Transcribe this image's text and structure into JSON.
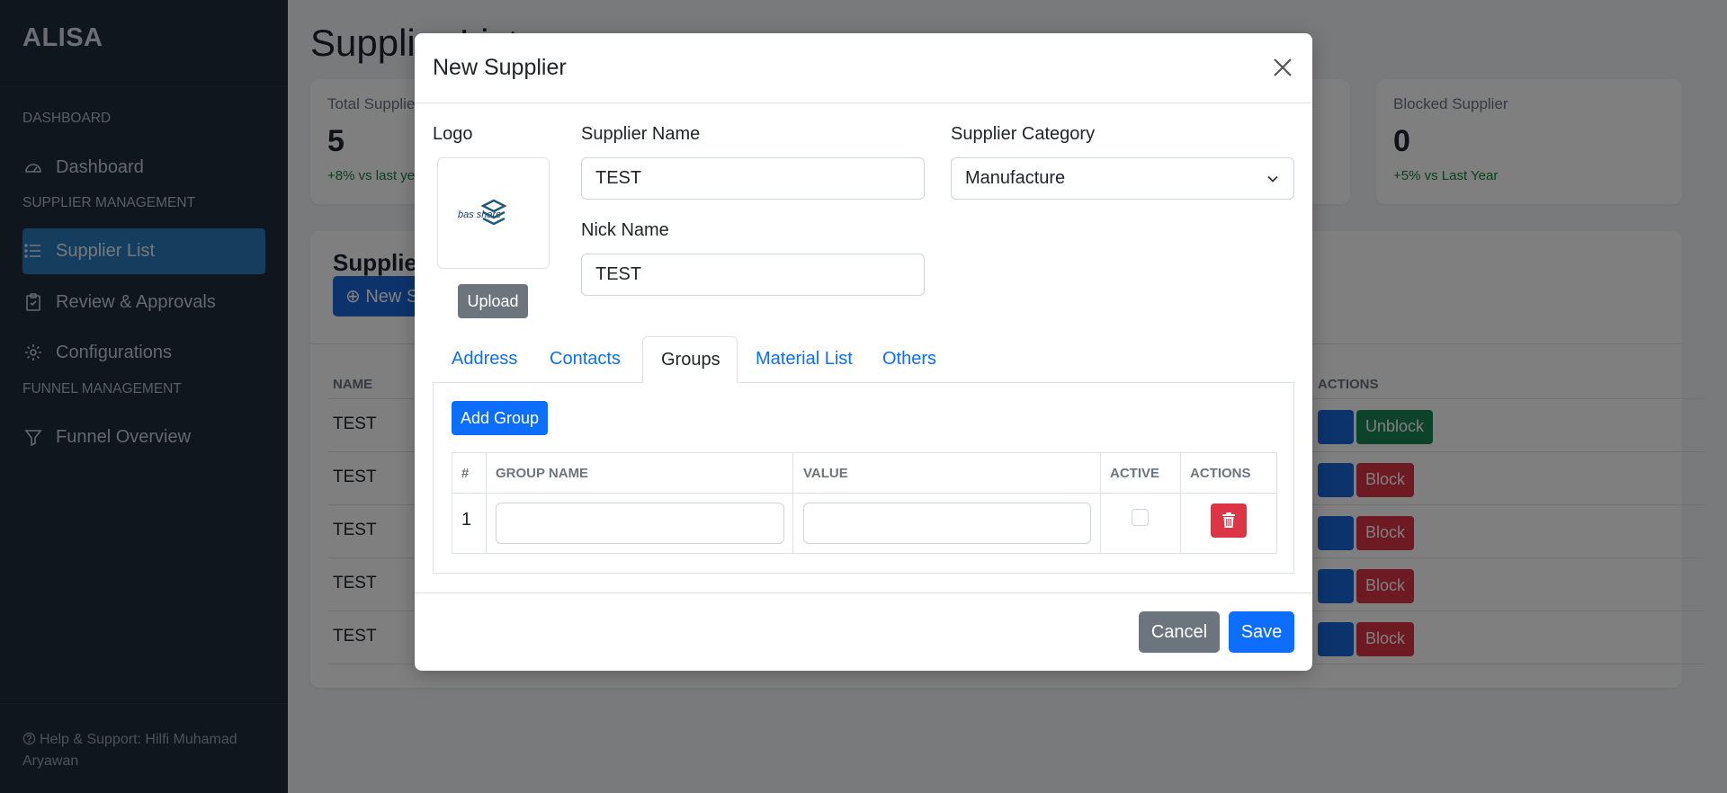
{
  "sidebar": {
    "brand": "ALISA",
    "sections": [
      "DASHBOARD",
      "SUPPLIER MANAGEMENT",
      "FUNNEL MANAGEMENT"
    ],
    "items": [
      {
        "label": "Dashboard",
        "icon": "gauge-icon"
      },
      {
        "label": "Supplier List",
        "icon": "list-icon",
        "active": true
      },
      {
        "label": "Review & Approvals",
        "icon": "clipboard-icon"
      },
      {
        "label": "Configurations",
        "icon": "gear-icon"
      },
      {
        "label": "Funnel Overview",
        "icon": "funnel-icon"
      }
    ],
    "footer": "Help & Support: Hilfi Muhamad Aryawan"
  },
  "page": {
    "title": "Supplier List",
    "stats": [
      {
        "label": "Total Supplier",
        "value": "5",
        "delta": "+8% vs last year"
      },
      {
        "label": "Blocked Supplier",
        "value": "0",
        "delta": "+5% vs Last Year"
      }
    ],
    "list_title": "Supplier List",
    "new_button": "New Supplier",
    "table": {
      "headers": [
        "NAME",
        "ACTIONS"
      ],
      "rows": [
        {
          "name": "TEST",
          "action": "Unblock"
        },
        {
          "name": "TEST",
          "action": "Block"
        },
        {
          "name": "TEST",
          "action": "Block"
        },
        {
          "name": "TEST",
          "action": "Block"
        },
        {
          "name": "TEST",
          "action": "Block"
        }
      ]
    }
  },
  "modal": {
    "title": "New Supplier",
    "logo_label": "Logo",
    "logo_text": "bas share",
    "upload_label": "Upload",
    "supplier_name_label": "Supplier Name",
    "supplier_name_value": "TEST",
    "nick_name_label": "Nick Name",
    "nick_name_value": "TEST",
    "category_label": "Supplier Category",
    "category_value": "Manufacture",
    "tabs": [
      {
        "label": "Address",
        "active": false
      },
      {
        "label": "Contacts",
        "active": false
      },
      {
        "label": "Groups",
        "active": true
      },
      {
        "label": "Material List",
        "active": false
      },
      {
        "label": "Others",
        "active": false
      }
    ],
    "add_group_label": "Add Group",
    "groups_table": {
      "headers": [
        "#",
        "GROUP NAME",
        "VALUE",
        "ACTIVE",
        "ACTIONS"
      ],
      "rows": [
        {
          "num": "1",
          "group_name": "",
          "value": "",
          "active": false
        }
      ]
    },
    "cancel_label": "Cancel",
    "save_label": "Save"
  },
  "colors": {
    "sidebar_bg": "#1f2d3d",
    "active_nav": "#2a7bbd",
    "primary": "#0d6efd",
    "danger": "#dc3545",
    "success": "#198754",
    "secondary": "#6c757d"
  }
}
